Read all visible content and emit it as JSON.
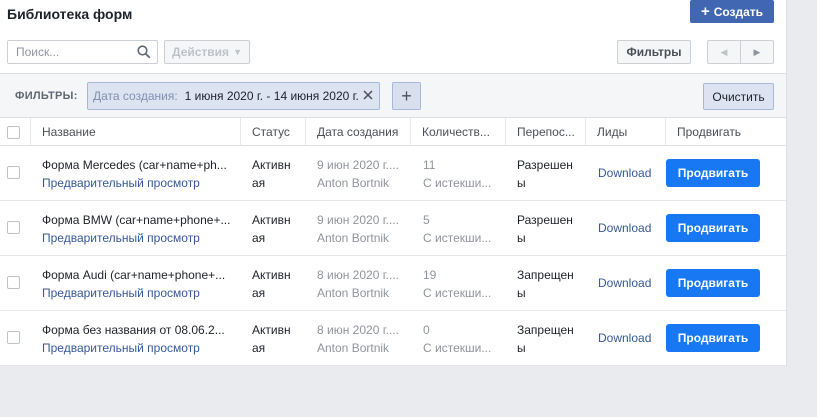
{
  "header": {
    "title": "Библиотека форм",
    "create_label": "Создать"
  },
  "toolbar": {
    "search_placeholder": "Поиск...",
    "actions_label": "Действия",
    "filters_label": "Фильтры"
  },
  "filterbar": {
    "label": "ФИЛЬТРЫ:",
    "chip_key": "Дата создания:",
    "chip_value": "1 июня 2020 г. - 14 июня 2020 г.",
    "clear_label": "Очистить"
  },
  "table": {
    "columns": [
      "Название",
      "Статус",
      "Дата создания",
      "Количеств...",
      "Перепос...",
      "Лиды",
      "Продвигать"
    ],
    "rows": [
      {
        "name": "Форма Mercedes (car+name+ph...",
        "preview": "Предварительный просмотр",
        "status1": "Активн",
        "status2": "ая",
        "date": "9 июн 2020 г....",
        "author": "Anton Bortnik",
        "count": "11",
        "count_sub": "С истекши...",
        "share1": "Разрешен",
        "share2": "ы",
        "leads": "Download",
        "promote": "Продвигать"
      },
      {
        "name": "Форма BMW (car+name+phone+...",
        "preview": "Предварительный просмотр",
        "status1": "Активн",
        "status2": "ая",
        "date": "9 июн 2020 г....",
        "author": "Anton Bortnik",
        "count": "5",
        "count_sub": "С истекши...",
        "share1": "Разрешен",
        "share2": "ы",
        "leads": "Download",
        "promote": "Продвигать"
      },
      {
        "name": "Форма Audi (car+name+phone+...",
        "preview": "Предварительный просмотр",
        "status1": "Активн",
        "status2": "ая",
        "date": "8 июн 2020 г....",
        "author": "Anton Bortnik",
        "count": "19",
        "count_sub": "С истекши...",
        "share1": "Запрещен",
        "share2": "ы",
        "leads": "Download",
        "promote": "Продвигать"
      },
      {
        "name": "Форма без названия от 08.06.2...",
        "preview": "Предварительный просмотр",
        "status1": "Активн",
        "status2": "ая",
        "date": "8 июн 2020 г....",
        "author": "Anton Bortnik",
        "count": "0",
        "count_sub": "С истекши...",
        "share1": "Запрещен",
        "share2": "ы",
        "leads": "Download",
        "promote": "Продвигать"
      }
    ]
  },
  "colors": {
    "create_bg": "#4267b2",
    "promote_bg": "#1877f2",
    "link": "#365899"
  }
}
